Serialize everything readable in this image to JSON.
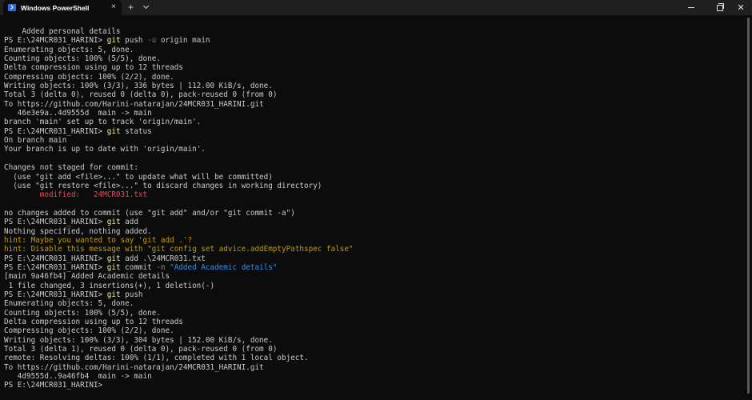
{
  "window": {
    "tab_title": "Windows PowerShell",
    "tab_close_glyph": "×",
    "new_tab_glyph": "+",
    "close_glyph": "✕"
  },
  "colors": {
    "background": "#0c0c0c",
    "text": "#cccccc",
    "command": "#f9f1a5",
    "parameter": "#767676",
    "string": "#3b8eea",
    "error": "#e74856",
    "hint": "#c19c00"
  },
  "terminal": {
    "lines": [
      [
        {
          "t": "    Added personal details"
        }
      ],
      [
        {
          "t": "PS E:\\24MCR031_HARINI> "
        },
        {
          "t": "git",
          "c": "cmd"
        },
        {
          "t": " push "
        },
        {
          "t": "-u",
          "c": "param"
        },
        {
          "t": " origin main"
        }
      ],
      [
        {
          "t": "Enumerating objects: 5, done."
        }
      ],
      [
        {
          "t": "Counting objects: 100% (5/5), done."
        }
      ],
      [
        {
          "t": "Delta compression using up to 12 threads"
        }
      ],
      [
        {
          "t": "Compressing objects: 100% (2/2), done."
        }
      ],
      [
        {
          "t": "Writing objects: 100% (3/3), 336 bytes | 112.00 KiB/s, done."
        }
      ],
      [
        {
          "t": "Total 3 (delta 0), reused 0 (delta 0), pack-reused 0 (from 0)"
        }
      ],
      [
        {
          "t": "To https://github.com/Harini-natarajan/24MCR031_HARINI.git"
        }
      ],
      [
        {
          "t": "   46e3e9a..4d9555d  main -> main"
        }
      ],
      [
        {
          "t": "branch 'main' set up to track 'origin/main'."
        }
      ],
      [
        {
          "t": "PS E:\\24MCR031_HARINI> "
        },
        {
          "t": "git",
          "c": "cmd"
        },
        {
          "t": " status"
        }
      ],
      [
        {
          "t": "On branch main"
        }
      ],
      [
        {
          "t": "Your branch is up to date with 'origin/main'."
        }
      ],
      [
        {
          "t": ""
        }
      ],
      [
        {
          "t": "Changes not staged for commit:"
        }
      ],
      [
        {
          "t": "  (use \"git add <file>...\" to update what will be committed)"
        }
      ],
      [
        {
          "t": "  (use \"git restore <file>...\" to discard changes in working directory)"
        }
      ],
      [
        {
          "t": "        modified:   24MCR031.txt",
          "c": "red"
        }
      ],
      [
        {
          "t": ""
        }
      ],
      [
        {
          "t": "no changes added to commit (use \"git add\" and/or \"git commit -a\")"
        }
      ],
      [
        {
          "t": "PS E:\\24MCR031_HARINI> "
        },
        {
          "t": "git",
          "c": "cmd"
        },
        {
          "t": " add"
        }
      ],
      [
        {
          "t": "Nothing specified, nothing added."
        }
      ],
      [
        {
          "t": "hint: Maybe you wanted to say 'git add .'?",
          "c": "warn"
        }
      ],
      [
        {
          "t": "hint: Disable this message with \"git config set advice.addEmptyPathspec false\"",
          "c": "warn"
        }
      ],
      [
        {
          "t": "PS E:\\24MCR031_HARINI> "
        },
        {
          "t": "git",
          "c": "cmd"
        },
        {
          "t": " add .\\24MCR031.txt"
        }
      ],
      [
        {
          "t": "PS E:\\24MCR031_HARINI> "
        },
        {
          "t": "git",
          "c": "cmd"
        },
        {
          "t": " commit "
        },
        {
          "t": "-m",
          "c": "param"
        },
        {
          "t": " "
        },
        {
          "t": "\"Added Academic details\"",
          "c": "str"
        }
      ],
      [
        {
          "t": "[main 9a46fb4] Added Academic details"
        }
      ],
      [
        {
          "t": " 1 file changed, 3 insertions(+), 1 deletion(-)"
        }
      ],
      [
        {
          "t": "PS E:\\24MCR031_HARINI> "
        },
        {
          "t": "git",
          "c": "cmd"
        },
        {
          "t": " push"
        }
      ],
      [
        {
          "t": "Enumerating objects: 5, done."
        }
      ],
      [
        {
          "t": "Counting objects: 100% (5/5), done."
        }
      ],
      [
        {
          "t": "Delta compression using up to 12 threads"
        }
      ],
      [
        {
          "t": "Compressing objects: 100% (2/2), done."
        }
      ],
      [
        {
          "t": "Writing objects: 100% (3/3), 304 bytes | 152.00 KiB/s, done."
        }
      ],
      [
        {
          "t": "Total 3 (delta 1), reused 0 (delta 0), pack-reused 0 (from 0)"
        }
      ],
      [
        {
          "t": "remote: Resolving deltas: 100% (1/1), completed with 1 local object."
        }
      ],
      [
        {
          "t": "To https://github.com/Harini-natarajan/24MCR031_HARINI.git"
        }
      ],
      [
        {
          "t": "   4d9555d..9a46fb4  main -> main"
        }
      ],
      [
        {
          "t": "PS E:\\24MCR031_HARINI> "
        }
      ]
    ]
  }
}
